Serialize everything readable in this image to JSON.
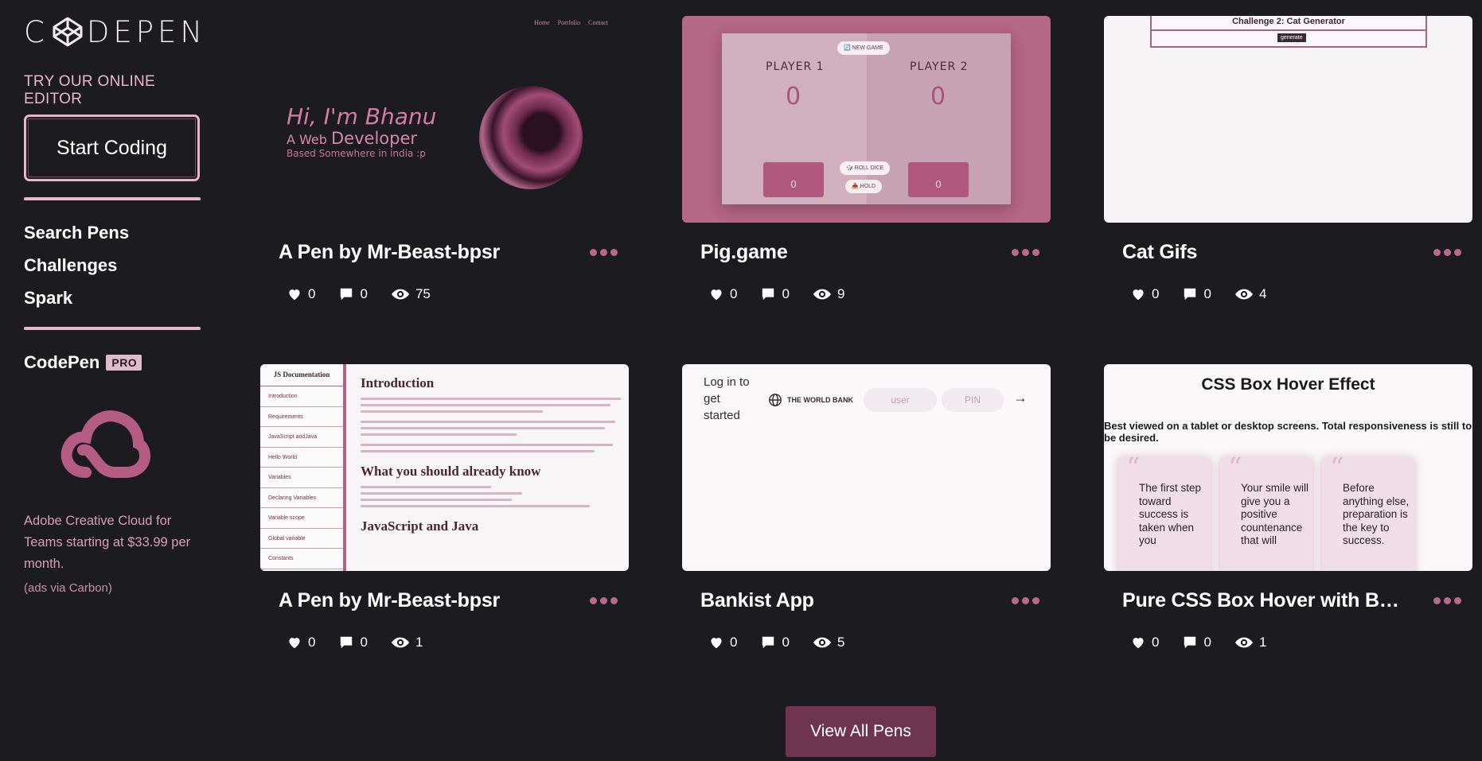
{
  "sidebar": {
    "logo_text_left": "C",
    "logo_text_right": "DEPEN",
    "try_label": "TRY OUR ONLINE EDITOR",
    "start_coding": "Start Coding",
    "nav": [
      "Search Pens",
      "Challenges",
      "Spark"
    ],
    "codepen_label": "CodePen",
    "pro_badge": "PRO",
    "ad_text": "Adobe Creative Cloud for Teams starting at $33.99 per month.",
    "ad_via": "(ads via Carbon)"
  },
  "pens": [
    {
      "title": "A Pen by Mr-Beast-bpsr",
      "likes": "0",
      "comments": "0",
      "views": "75",
      "thumb": {
        "nav": "Home Portfolio Contact",
        "hi": "Hi, I'm Bhanu",
        "a_web": "A Web",
        "developer": "Developer",
        "based": "Based Somewhere in india :p"
      }
    },
    {
      "title": "Pig.game",
      "likes": "0",
      "comments": "0",
      "views": "9",
      "thumb": {
        "player1": "PLAYER 1",
        "player2": "PLAYER 2",
        "score1": "0",
        "score2": "0",
        "current1": "0",
        "current2": "0",
        "new_game": "🔄 NEW GAME",
        "roll": "🎲 ROLL DICE",
        "hold": "📥 HOLD"
      }
    },
    {
      "title": "Cat Gifs",
      "likes": "0",
      "comments": "0",
      "views": "4",
      "thumb": {
        "challenge": "Challenge 2: Cat Generator",
        "generate": "generate"
      }
    },
    {
      "title": "A Pen by Mr-Beast-bpsr",
      "likes": "0",
      "comments": "0",
      "views": "1",
      "thumb": {
        "doc_title": "JS Documentation",
        "items": [
          "Introduction",
          "Requirements",
          "JavaScript andJava",
          "Hello World",
          "Variables",
          "Declaring Variables",
          "Variable scope",
          "Global variable",
          "Constants"
        ],
        "h1": "Introduction",
        "h2": "What you should already know",
        "h3": "JavaScript and Java"
      }
    },
    {
      "title": "Bankist App",
      "likes": "0",
      "comments": "0",
      "views": "5",
      "thumb": {
        "login": "Log in to get started",
        "bank": "THE WORLD BANK",
        "user": "user",
        "pin": "PIN",
        "arrow": "→"
      }
    },
    {
      "title": "Pure CSS Box Hover with B…",
      "likes": "0",
      "comments": "0",
      "views": "1",
      "thumb": {
        "heading": "CSS Box Hover Effect",
        "para": "Best viewed on a tablet or desktop screens. Total responsiveness is still to be desired.",
        "boxes": [
          "The first step toward success is taken when you",
          "Your smile will give you a positive countenance that will",
          "Before anything else, preparation is the key to success."
        ]
      }
    }
  ],
  "view_all": "View All Pens",
  "colors": {
    "background": "#1c1b20",
    "accent": "#e9b8c8",
    "button": "#6e3450",
    "dots": "#b86a8c"
  }
}
